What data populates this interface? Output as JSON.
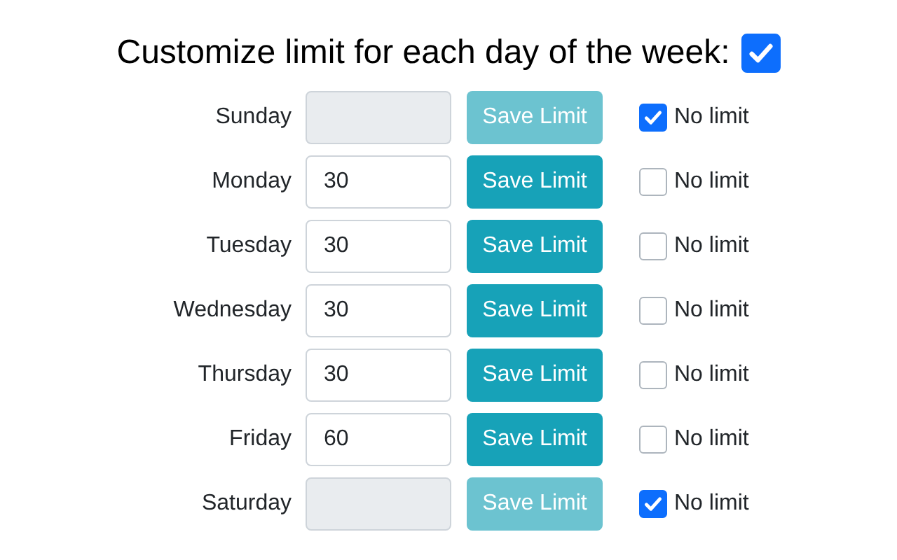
{
  "title": "Customize limit for each day of the week:",
  "customize_enabled": {
    "checked": true
  },
  "days": [
    {
      "name": "Sunday",
      "button": "Save Limit",
      "no_limit_label": "No limit",
      "no_limit": true
    },
    {
      "name": "Monday",
      "value": "30",
      "button": "Save Limit",
      "no_limit_label": "No limit",
      "no_limit": false
    },
    {
      "name": "Tuesday",
      "value": "30",
      "button": "Save Limit",
      "no_limit_label": "No limit",
      "no_limit": false
    },
    {
      "name": "Wednesday",
      "value": "30",
      "button": "Save Limit",
      "no_limit_label": "No limit",
      "no_limit": false
    },
    {
      "name": "Thursday",
      "value": "30",
      "button": "Save Limit",
      "no_limit_label": "No limit",
      "no_limit": false
    },
    {
      "name": "Friday",
      "value": "60",
      "button": "Save Limit",
      "no_limit_label": "No limit",
      "no_limit": false
    },
    {
      "name": "Saturday",
      "button": "Save Limit",
      "no_limit_label": "No limit",
      "no_limit": true
    }
  ]
}
